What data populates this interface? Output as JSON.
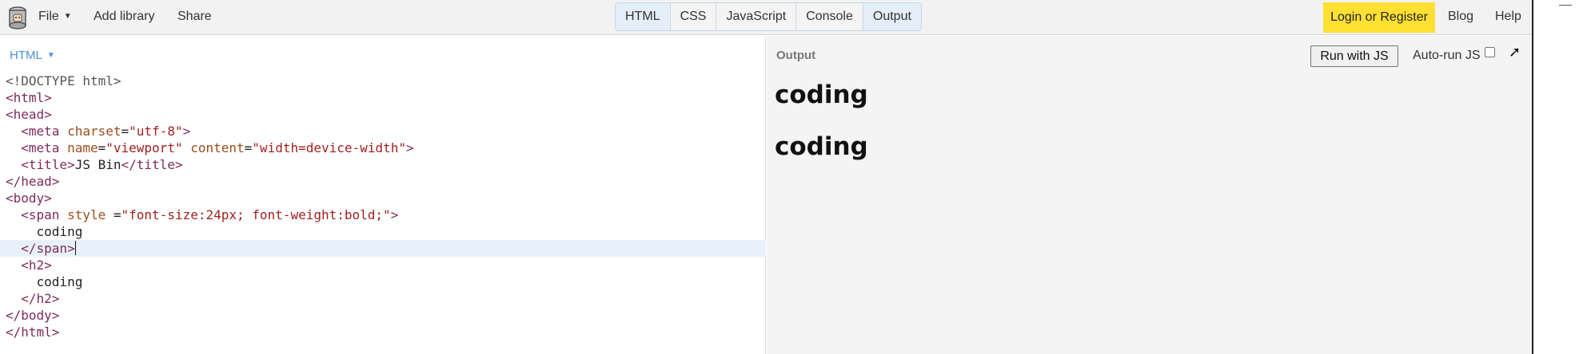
{
  "toolbar": {
    "logo": "jsbin-logo-icon",
    "file_label": "File",
    "add_library_label": "Add library",
    "share_label": "Share",
    "panels": [
      "HTML",
      "CSS",
      "JavaScript",
      "Console",
      "Output"
    ],
    "active_panels": [
      "HTML",
      "Output"
    ],
    "login_label": "Login or Register",
    "blog_label": "Blog",
    "help_label": "Help",
    "login_color": "#ffe033"
  },
  "editor": {
    "language_label": "HTML",
    "lines": [
      "<!DOCTYPE html>",
      "<html>",
      "<head>",
      "  <meta charset=\"utf-8\">",
      "  <meta name=\"viewport\" content=\"width=device-width\">",
      "  <title>JS Bin</title>",
      "</head>",
      "<body>",
      "  <span style =\"font-size:24px; font-weight:bold;\">",
      "    coding",
      "  </span>",
      "  <h2>",
      "    coding",
      "  </h2>",
      "</body>",
      "</html>"
    ],
    "active_line": 10
  },
  "output": {
    "label": "Output",
    "run_button_label": "Run with JS",
    "autorun_label": "Auto-run JS",
    "autorun_checked": false,
    "popout_icon": "popout-arrow-icon",
    "span_text": "coding",
    "h2_text": "coding"
  }
}
